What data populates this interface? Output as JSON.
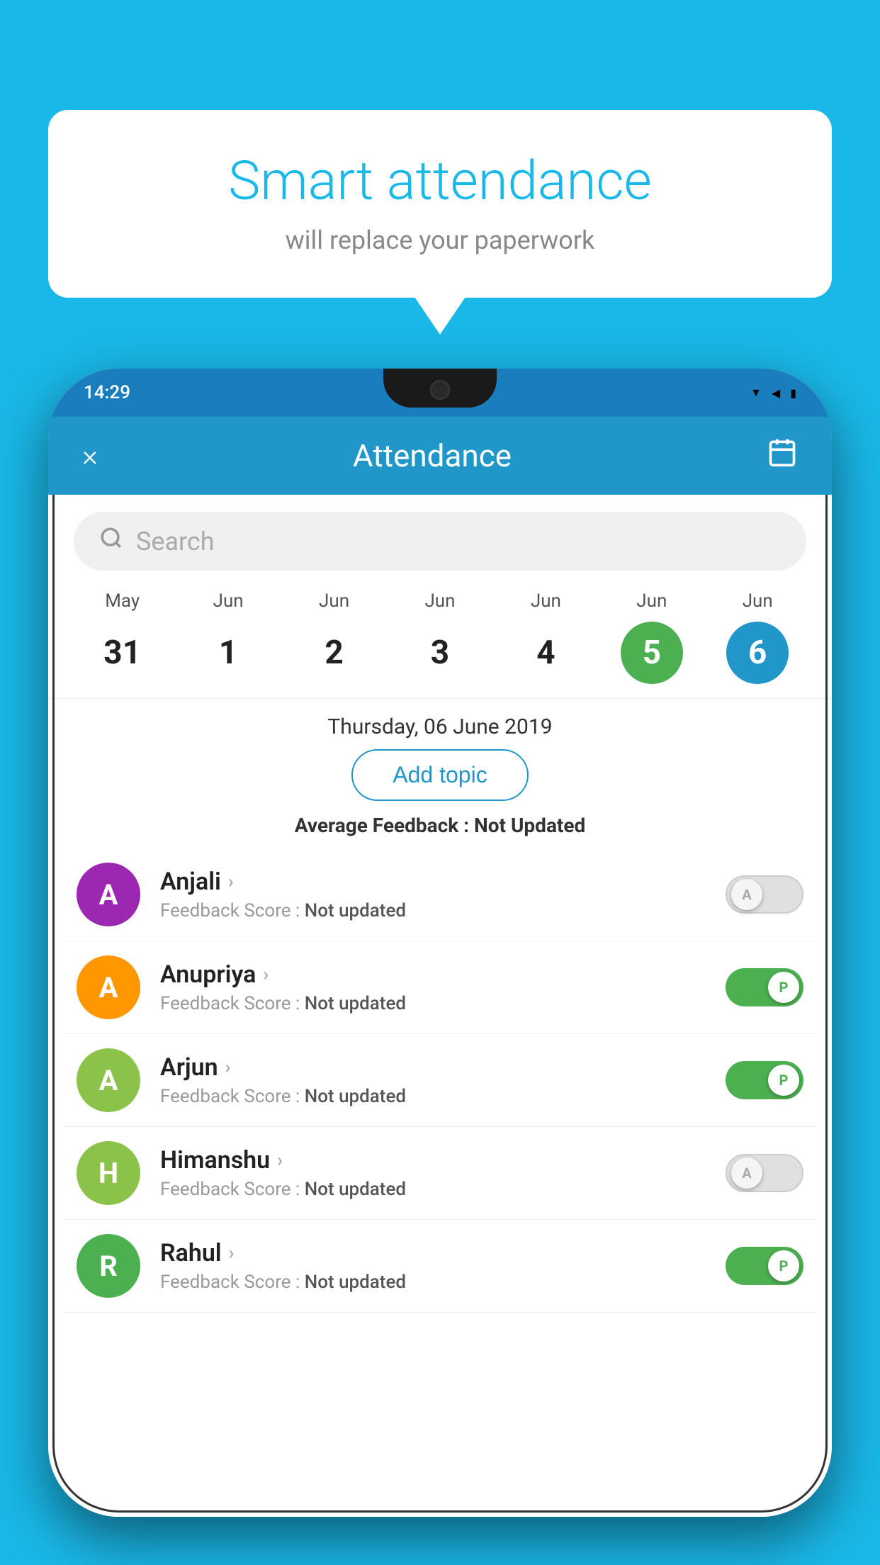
{
  "background_color": "#1ab8e8",
  "speech_bubble": {
    "title": "Smart attendance",
    "subtitle": "will replace your paperwork"
  },
  "status_bar": {
    "time": "14:29",
    "icons": [
      "wifi",
      "signal",
      "battery"
    ]
  },
  "toolbar": {
    "title": "Attendance",
    "close_label": "×",
    "calendar_label": "📅"
  },
  "search": {
    "placeholder": "Search"
  },
  "calendar": {
    "days": [
      {
        "month": "May",
        "date": "31",
        "state": "normal"
      },
      {
        "month": "Jun",
        "date": "1",
        "state": "normal"
      },
      {
        "month": "Jun",
        "date": "2",
        "state": "normal"
      },
      {
        "month": "Jun",
        "date": "3",
        "state": "normal"
      },
      {
        "month": "Jun",
        "date": "4",
        "state": "normal"
      },
      {
        "month": "Jun",
        "date": "5",
        "state": "today"
      },
      {
        "month": "Jun",
        "date": "6",
        "state": "selected"
      }
    ]
  },
  "selected_date": "Thursday, 06 June 2019",
  "add_topic_label": "Add topic",
  "average_feedback": {
    "label": "Average Feedback : ",
    "value": "Not Updated"
  },
  "students": [
    {
      "name": "Anjali",
      "avatar_letter": "A",
      "avatar_color": "#9c27b0",
      "feedback_label": "Feedback Score : ",
      "feedback_value": "Not updated",
      "attendance": "absent",
      "toggle_label": "A"
    },
    {
      "name": "Anupriya",
      "avatar_letter": "A",
      "avatar_color": "#ff9800",
      "feedback_label": "Feedback Score : ",
      "feedback_value": "Not updated",
      "attendance": "present",
      "toggle_label": "P"
    },
    {
      "name": "Arjun",
      "avatar_letter": "A",
      "avatar_color": "#8bc34a",
      "feedback_label": "Feedback Score : ",
      "feedback_value": "Not updated",
      "attendance": "present",
      "toggle_label": "P"
    },
    {
      "name": "Himanshu",
      "avatar_letter": "H",
      "avatar_color": "#8bc34a",
      "feedback_label": "Feedback Score : ",
      "feedback_value": "Not updated",
      "attendance": "absent",
      "toggle_label": "A"
    },
    {
      "name": "Rahul",
      "avatar_letter": "R",
      "avatar_color": "#4caf50",
      "feedback_label": "Feedback Score : ",
      "feedback_value": "Not updated",
      "attendance": "present",
      "toggle_label": "P"
    }
  ]
}
